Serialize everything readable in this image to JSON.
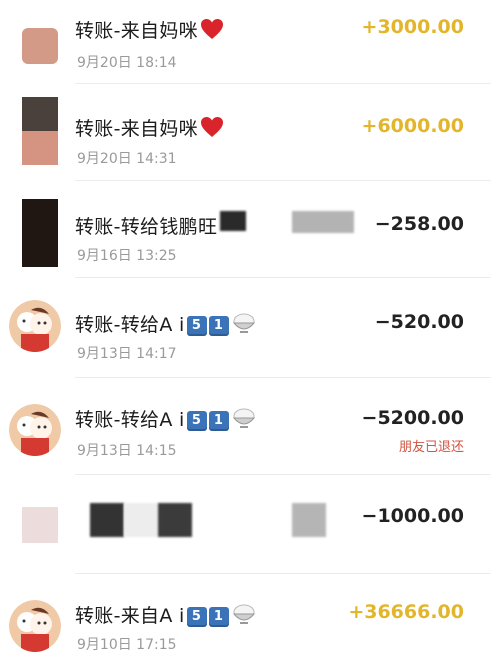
{
  "transactions": [
    {
      "title": "转账-来自妈咪",
      "time": "9月20日 18:14",
      "amount": "+3000.00",
      "type": "income",
      "avatar": "pink-block"
    },
    {
      "title": "转账-来自妈咪",
      "time": "9月20日 14:31",
      "amount": "+6000.00",
      "type": "income",
      "avatar": "split-block"
    },
    {
      "title": "转账-转给钱鹏旺",
      "time": "9月16日 13:25",
      "amount": "−258.00",
      "type": "expense",
      "avatar": "dark-block"
    },
    {
      "title": "转账-转给A i",
      "badges": [
        "5",
        "1"
      ],
      "time": "9月13日 14:17",
      "amount": "−520.00",
      "type": "expense",
      "avatar": "cartoon"
    },
    {
      "title": "转账-转给A i",
      "badges": [
        "5",
        "1"
      ],
      "time": "9月13日 14:15",
      "amount": "−5200.00",
      "type": "expense",
      "status": "朋友已退还",
      "avatar": "cartoon"
    },
    {
      "time": "",
      "amount": "−1000.00",
      "type": "expense",
      "avatar": "pale-block"
    },
    {
      "title": "转账-来自A i",
      "badges": [
        "5",
        "1"
      ],
      "time": "9月10日 17:15",
      "amount": "+36666.00",
      "type": "income",
      "avatar": "cartoon"
    }
  ],
  "colors": {
    "income": "#e3b52b",
    "expense": "#222222",
    "status_refund": "#d05543",
    "badge": "#3a73b7"
  }
}
